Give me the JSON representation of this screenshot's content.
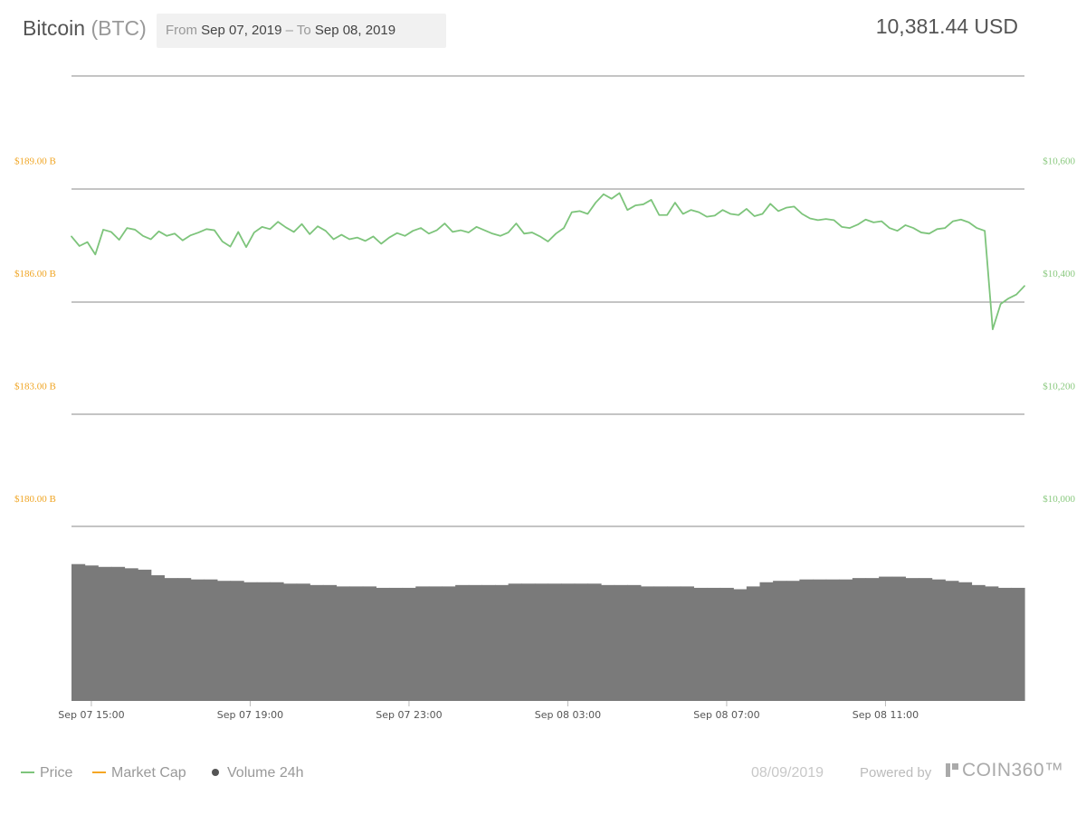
{
  "header": {
    "coin_name": "Bitcoin",
    "coin_symbol": "(BTC)",
    "range_from_label": "From",
    "range_from": "Sep 07, 2019",
    "range_sep": "–",
    "range_to_label": "To",
    "range_to": "Sep 08, 2019",
    "current_price": "10,381.44 USD"
  },
  "footer": {
    "legend": {
      "price": "Price",
      "market_cap": "Market Cap",
      "volume": "Volume 24h"
    },
    "date": "08/09/2019",
    "powered_by": "Powered by",
    "brand": "COIN360™"
  },
  "colors": {
    "price": "#7dc47b",
    "market_cap": "#f5a623",
    "volume": "#7a7a7a",
    "left_axis": "#f0a626",
    "right_axis": "#8ac97f",
    "grid": "#888888"
  },
  "chart_data": {
    "type": "line",
    "x_tick_labels": [
      "Sep 07 15:00",
      "Sep 07 19:00",
      "Sep 07 23:00",
      "Sep 08 03:00",
      "Sep 08 07:00",
      "Sep 08 11:00"
    ],
    "x_tick_hours": [
      15,
      19,
      23,
      27,
      31,
      35
    ],
    "x_range_hours": [
      14.5,
      38.5
    ],
    "left_axis": {
      "label": "Market Cap",
      "ticks": [
        "$180.00 B",
        "$183.00 B",
        "$186.00 B",
        "$189.00 B"
      ],
      "values": [
        180,
        183,
        186,
        189
      ],
      "unit": "B USD"
    },
    "right_axis": {
      "label": "Price",
      "ticks": [
        "$10,000",
        "$10,200",
        "$10,400",
        "$10,600"
      ],
      "values": [
        10000,
        10200,
        10400,
        10600
      ],
      "range": [
        9950,
        10750
      ]
    },
    "series": [
      {
        "name": "Price",
        "axis": "right",
        "points": [
          [
            14.5,
            10465
          ],
          [
            14.7,
            10448
          ],
          [
            14.9,
            10455
          ],
          [
            15.1,
            10433
          ],
          [
            15.3,
            10477
          ],
          [
            15.5,
            10473
          ],
          [
            15.7,
            10459
          ],
          [
            15.9,
            10480
          ],
          [
            16.1,
            10477
          ],
          [
            16.3,
            10466
          ],
          [
            16.5,
            10460
          ],
          [
            16.7,
            10474
          ],
          [
            16.9,
            10466
          ],
          [
            17.1,
            10470
          ],
          [
            17.3,
            10458
          ],
          [
            17.5,
            10467
          ],
          [
            17.7,
            10472
          ],
          [
            17.9,
            10478
          ],
          [
            18.1,
            10476
          ],
          [
            18.3,
            10456
          ],
          [
            18.5,
            10447
          ],
          [
            18.7,
            10473
          ],
          [
            18.9,
            10446
          ],
          [
            19.1,
            10472
          ],
          [
            19.3,
            10482
          ],
          [
            19.5,
            10478
          ],
          [
            19.7,
            10491
          ],
          [
            19.9,
            10481
          ],
          [
            20.1,
            10473
          ],
          [
            20.3,
            10487
          ],
          [
            20.5,
            10469
          ],
          [
            20.7,
            10483
          ],
          [
            20.9,
            10475
          ],
          [
            21.1,
            10460
          ],
          [
            21.3,
            10468
          ],
          [
            21.5,
            10460
          ],
          [
            21.7,
            10463
          ],
          [
            21.9,
            10457
          ],
          [
            22.1,
            10465
          ],
          [
            22.3,
            10452
          ],
          [
            22.5,
            10463
          ],
          [
            22.7,
            10471
          ],
          [
            22.9,
            10466
          ],
          [
            23.1,
            10475
          ],
          [
            23.3,
            10480
          ],
          [
            23.5,
            10470
          ],
          [
            23.7,
            10476
          ],
          [
            23.9,
            10488
          ],
          [
            24.1,
            10473
          ],
          [
            24.3,
            10476
          ],
          [
            24.5,
            10472
          ],
          [
            24.7,
            10482
          ],
          [
            24.9,
            10476
          ],
          [
            25.1,
            10470
          ],
          [
            25.3,
            10466
          ],
          [
            25.5,
            10472
          ],
          [
            25.7,
            10488
          ],
          [
            25.9,
            10470
          ],
          [
            26.1,
            10472
          ],
          [
            26.3,
            10465
          ],
          [
            26.5,
            10456
          ],
          [
            26.7,
            10470
          ],
          [
            26.9,
            10480
          ],
          [
            27.1,
            10508
          ],
          [
            27.3,
            10510
          ],
          [
            27.5,
            10505
          ],
          [
            27.7,
            10525
          ],
          [
            27.9,
            10540
          ],
          [
            28.1,
            10532
          ],
          [
            28.3,
            10542
          ],
          [
            28.5,
            10512
          ],
          [
            28.7,
            10520
          ],
          [
            28.9,
            10522
          ],
          [
            29.1,
            10530
          ],
          [
            29.3,
            10503
          ],
          [
            29.5,
            10503
          ],
          [
            29.7,
            10525
          ],
          [
            29.9,
            10505
          ],
          [
            30.1,
            10512
          ],
          [
            30.3,
            10508
          ],
          [
            30.5,
            10500
          ],
          [
            30.7,
            10502
          ],
          [
            30.9,
            10512
          ],
          [
            31.1,
            10505
          ],
          [
            31.3,
            10503
          ],
          [
            31.5,
            10514
          ],
          [
            31.7,
            10501
          ],
          [
            31.9,
            10505
          ],
          [
            32.1,
            10523
          ],
          [
            32.3,
            10510
          ],
          [
            32.5,
            10516
          ],
          [
            32.7,
            10518
          ],
          [
            32.9,
            10505
          ],
          [
            33.1,
            10497
          ],
          [
            33.3,
            10494
          ],
          [
            33.5,
            10496
          ],
          [
            33.7,
            10494
          ],
          [
            33.9,
            10482
          ],
          [
            34.1,
            10480
          ],
          [
            34.3,
            10486
          ],
          [
            34.5,
            10495
          ],
          [
            34.7,
            10490
          ],
          [
            34.9,
            10492
          ],
          [
            35.1,
            10480
          ],
          [
            35.3,
            10475
          ],
          [
            35.5,
            10485
          ],
          [
            35.7,
            10480
          ],
          [
            35.9,
            10472
          ],
          [
            36.1,
            10470
          ],
          [
            36.3,
            10478
          ],
          [
            36.5,
            10480
          ],
          [
            36.7,
            10492
          ],
          [
            36.9,
            10495
          ],
          [
            37.1,
            10490
          ],
          [
            37.3,
            10480
          ],
          [
            37.5,
            10475
          ],
          [
            37.7,
            10300
          ],
          [
            37.9,
            10345
          ],
          [
            38.1,
            10355
          ],
          [
            38.3,
            10362
          ],
          [
            38.5,
            10377
          ]
        ]
      },
      {
        "name": "Volume 24h",
        "axis": "none",
        "relative_levels": [
          0.98,
          0.97,
          0.96,
          0.96,
          0.95,
          0.94,
          0.9,
          0.88,
          0.88,
          0.87,
          0.87,
          0.86,
          0.86,
          0.85,
          0.85,
          0.85,
          0.84,
          0.84,
          0.83,
          0.83,
          0.82,
          0.82,
          0.82,
          0.81,
          0.81,
          0.81,
          0.82,
          0.82,
          0.82,
          0.83,
          0.83,
          0.83,
          0.83,
          0.84,
          0.84,
          0.84,
          0.84,
          0.84,
          0.84,
          0.84,
          0.83,
          0.83,
          0.83,
          0.82,
          0.82,
          0.82,
          0.82,
          0.81,
          0.81,
          0.81,
          0.8,
          0.82,
          0.85,
          0.86,
          0.86,
          0.87,
          0.87,
          0.87,
          0.87,
          0.88,
          0.88,
          0.89,
          0.89,
          0.88,
          0.88,
          0.87,
          0.86,
          0.85,
          0.83,
          0.82,
          0.81,
          0.81
        ]
      }
    ],
    "grid": true,
    "legend_placement": "bottom-left"
  }
}
